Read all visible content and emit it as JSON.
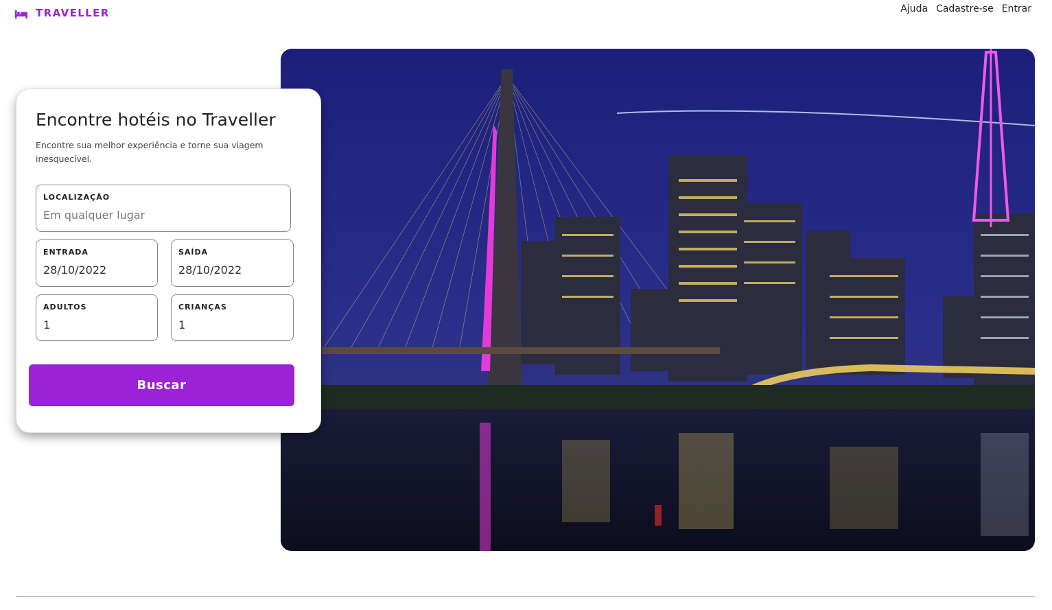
{
  "header": {
    "brand_icon": "bed-icon",
    "brand_name": "TRAVELLER",
    "nav": [
      {
        "label": "Ajuda"
      },
      {
        "label": "Cadastre-se"
      },
      {
        "label": "Entrar"
      }
    ]
  },
  "search_card": {
    "title": "Encontre hotéis no Traveller",
    "subtitle": "Encontre sua melhor experiência e torne sua viagem inesquecível.",
    "location": {
      "label": "LOCALIZAÇÃO",
      "placeholder": "Em qualquer lugar",
      "value": ""
    },
    "checkin": {
      "label": "ENTRADA",
      "value": "28/10/2022"
    },
    "checkout": {
      "label": "SAÍDA",
      "value": "28/10/2022"
    },
    "adults": {
      "label": "ADULTOS",
      "value": "1"
    },
    "children": {
      "label": "CRIANÇAS",
      "value": "1"
    },
    "search_button": "Buscar"
  },
  "hero_image": {
    "name": "night-city-bridge-photo"
  },
  "colors": {
    "accent": "#9b22d6"
  }
}
